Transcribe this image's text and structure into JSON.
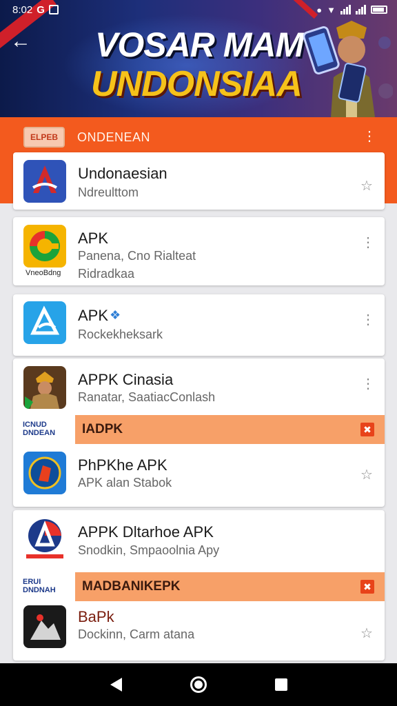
{
  "status_bar": {
    "time": "8:02",
    "g_label": "G"
  },
  "banner": {
    "line1": "VOSAR MAM",
    "line2": "UNDONSIAA",
    "back_icon": "arrow-left-icon"
  },
  "header": {
    "badge_text": "ELPEB",
    "label": "ONDENEAN",
    "menu_icon": "more-vert-icon"
  },
  "items": [
    {
      "title": "Undonaesian",
      "subtitle": "Ndreulttom",
      "subtitle2": "",
      "icon_label": "",
      "action": "star-outline-icon",
      "icon_colors": [
        "#2f53b8",
        "#d22a2a"
      ]
    },
    {
      "title": "APK",
      "subtitle": "Panena, Cno Rialteat",
      "subtitle2": "Ridradkaa",
      "icon_label": "VneoBdng",
      "action": "more-vert-icon",
      "icon_colors": [
        "#f5b400",
        "#1ba33b"
      ]
    },
    {
      "title": "APK",
      "subtitle": "Rockekheksark",
      "subtitle2": "",
      "icon_label": "",
      "action": "more-vert-icon",
      "icon_colors": [
        "#27a3e8",
        "#ffffff"
      ]
    },
    {
      "title": "APPK Cinasia",
      "subtitle": "Ranatar, SaatiacConlash",
      "subtitle2": "",
      "icon_label": "",
      "action": "more-vert-icon",
      "icon_colors": [
        "#5a3a1e",
        "#b2884a"
      ]
    },
    {
      "title": "PhPKhe APK",
      "subtitle": "APK alan Stabok",
      "subtitle2": "",
      "icon_label": "",
      "action": "star-outline-icon",
      "icon_colors": [
        "#1f7bd6",
        "#e8401d"
      ]
    },
    {
      "title": "APPK Dltarhoe APK",
      "subtitle": "Snodkin, Smpaoolnia Apy",
      "subtitle2": "",
      "icon_label": "",
      "action": "",
      "icon_colors": [
        "#e8312a",
        "#1d3a8a"
      ]
    },
    {
      "title": "BaPk",
      "subtitle": "Dockinn, Carm atana",
      "subtitle2": "",
      "icon_label": "",
      "action": "star-outline-icon",
      "icon_colors": [
        "#1a1a1a",
        "#d4d4d4"
      ]
    }
  ],
  "promos": [
    {
      "logo_text": "ICNUD DNDEAN",
      "label": "IADPK",
      "close_icon": "close-icon"
    },
    {
      "logo_text": "ERUI DNDNAH",
      "label": "MADBANIKEPK",
      "close_icon": "close-icon"
    }
  ],
  "nav": {
    "back": "nav-back-icon",
    "home": "nav-home-icon",
    "recent": "nav-recent-icon"
  }
}
